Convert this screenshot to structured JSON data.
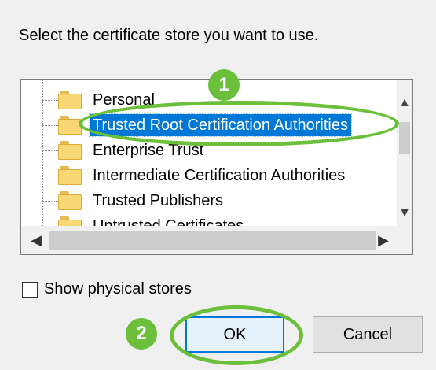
{
  "dialog": {
    "prompt": "Select the certificate store you want to use."
  },
  "store_tree": {
    "items": [
      {
        "label": "Personal",
        "selected": false
      },
      {
        "label": "Trusted Root Certification Authorities",
        "selected": true
      },
      {
        "label": "Enterprise Trust",
        "selected": false
      },
      {
        "label": "Intermediate Certification Authorities",
        "selected": false
      },
      {
        "label": "Trusted Publishers",
        "selected": false
      },
      {
        "label": "Untrusted Certificates",
        "selected": false
      }
    ],
    "icons": {
      "item": "folder-icon"
    },
    "scroll": {
      "up": "▲",
      "down": "▼",
      "left": "◀",
      "right": "▶"
    }
  },
  "options": {
    "show_physical_stores_label": "Show physical stores",
    "show_physical_stores_checked": false
  },
  "buttons": {
    "ok_label": "OK",
    "cancel_label": "Cancel"
  },
  "annotations": {
    "step1": "1",
    "step2": "2",
    "accent_color": "#6bbf3b"
  },
  "colors": {
    "selection": "#0078d7"
  }
}
